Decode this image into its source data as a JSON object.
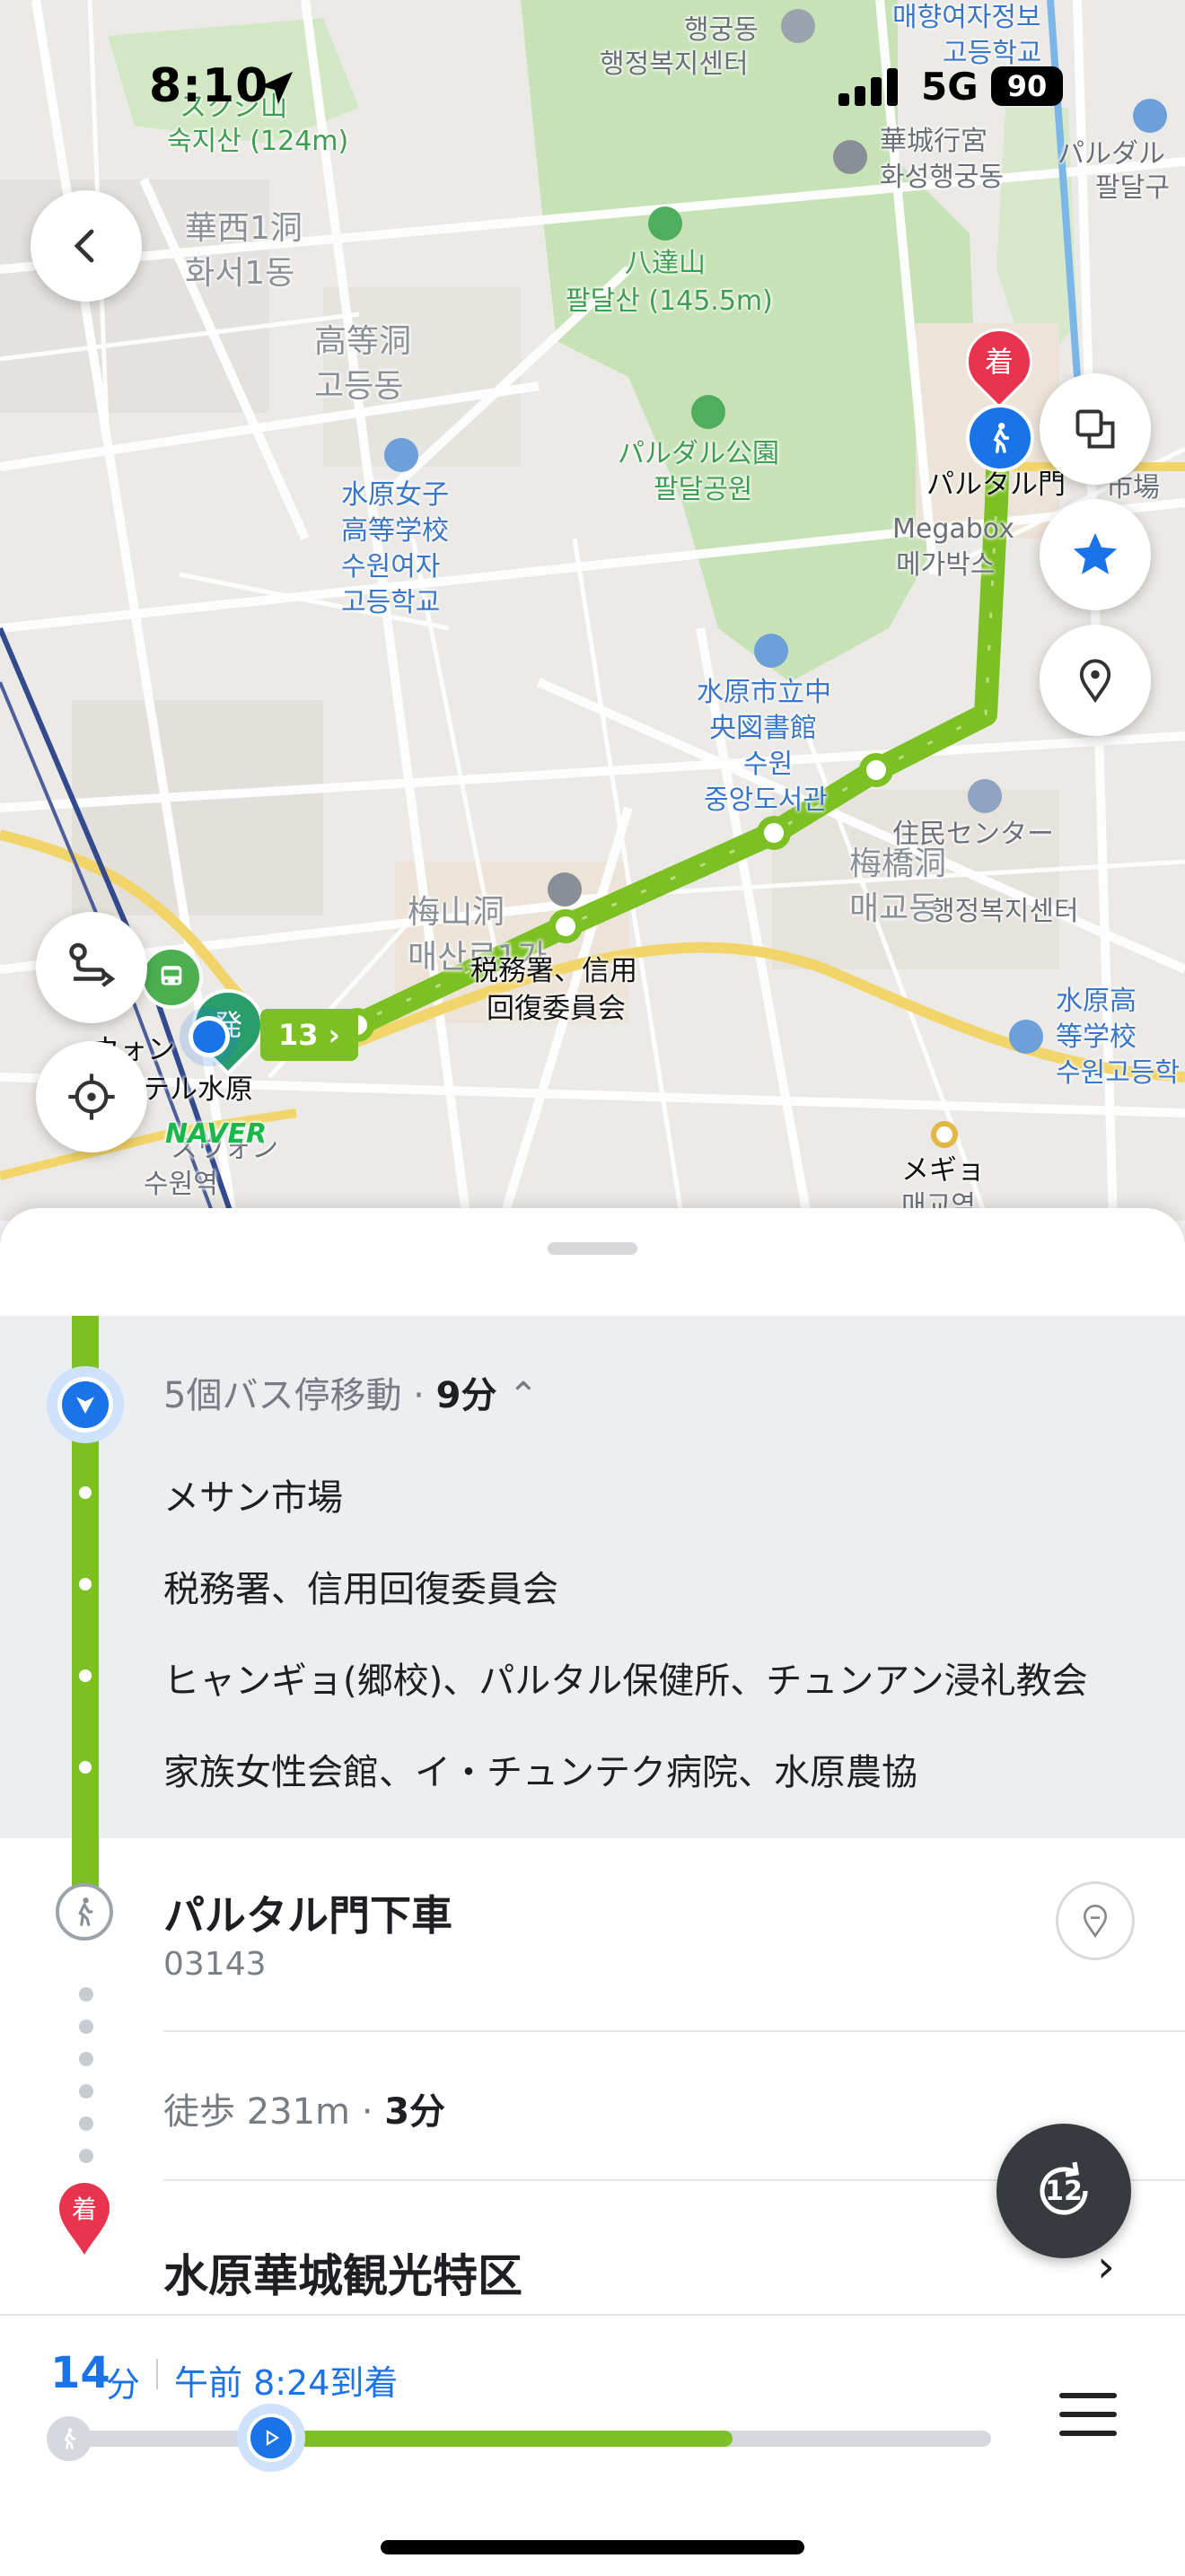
{
  "status_bar": {
    "time": "8:10",
    "network": "5G",
    "battery": "90"
  },
  "map": {
    "labels": {
      "mountain1_jp": "スクジ山",
      "mountain1_kr": "숙지산 (124m)",
      "hwaseo_jp": "華西1洞",
      "hwaseo_kr": "화서1동",
      "godeung_jp": "高等洞",
      "godeung_kr": "고등동",
      "school1_jp1": "水原女子",
      "school1_jp2": "高等学校",
      "school1_kr1": "수원여자",
      "school1_kr2": "고등학교",
      "haenggung_kr1": "행궁동",
      "haenggung_kr2": "행정복지센터",
      "paldal_jp": "八達山",
      "paldal_kr": "팔달산 (145.5m)",
      "park_jp": "パルダル公園",
      "park_kr": "팔달공원",
      "library_jp1": "水原市立中",
      "library_jp2": "央図書館",
      "library_kr1": "수원",
      "library_kr2": "중앙도서관",
      "hwaseong_jp": "華城行宮",
      "hwaseong_kr": "화성행궁동",
      "girls_info1": "매향여자정보",
      "girls_info2": "고등학교",
      "paldalgu1": "パルダル",
      "paldalgu2": "팔달구",
      "paldalmun": "パルタル門",
      "market": "市場",
      "megabox_en": "Megabox",
      "megabox_kr": "메가박스",
      "maegyo_jp": "梅橋洞",
      "maegyo_kr": "매교동",
      "residents_jp": "住民センター",
      "residents_kr": "행정복지센터",
      "maesan_jp": "梅山洞",
      "maesan_kr": "매산로1가",
      "tax_office1": "税務署、信用",
      "tax_office2": "回復委員会",
      "school2_jp1": "水原高",
      "school2_jp2": "等学校",
      "school2_kr": "수원고등학",
      "maegyo_stn_jp": "メギョ",
      "maegyo_stn_kr": "매교역",
      "suwon_stn_jp": "スウォン",
      "suwon_stn_kr": "수원역",
      "hotel": "テル水原",
      "ibis": "ウォン",
      "naver": "NAVER",
      "bus_number": "13",
      "arrive_badge": "着",
      "depart_badge": "発"
    }
  },
  "segment": {
    "summary_prefix": "5個バス停移動",
    "summary_time": "9分",
    "stops": [
      "メサン市場",
      "税務署、信用回復委員会",
      "ヒャンギョ(郷校)、パルタル保健所、チュンアン浸礼教会",
      "家族女性会館、イ・チュンテク病院、水原農協"
    ]
  },
  "alight": {
    "title": "パルタル門下車",
    "code": "03143"
  },
  "walk": {
    "label": "徒歩 231m",
    "time": "3分"
  },
  "destination": {
    "title": "水原華城観光特区",
    "badge": "着"
  },
  "replay": {
    "label": "12"
  },
  "eta": {
    "minutes": "14",
    "unit": "分",
    "arrive_text": "午前 8:24到着",
    "progress_fraction": 0.22,
    "transit_end_fraction": 0.72
  },
  "colors": {
    "route_green": "#7cc023",
    "accent_blue": "#1a73e8",
    "arrive_red": "#e8344e",
    "bus_green": "#4caf50"
  }
}
